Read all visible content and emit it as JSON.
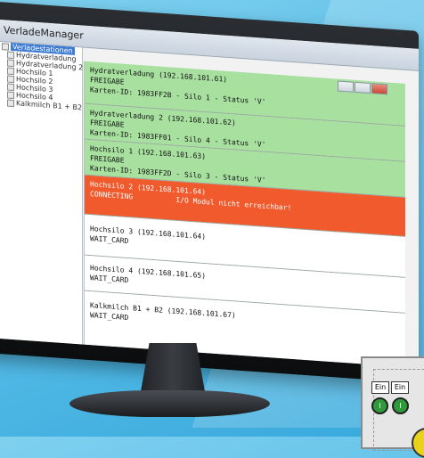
{
  "window": {
    "title": "VerladeManager"
  },
  "tree": {
    "root": "Verladestationen",
    "items": [
      "Hydratverladung",
      "Hydratverladung 2",
      "Hochsilo 1",
      "Hochsilo 2",
      "Hochsilo 3",
      "Hochsilo 4",
      "Kalkmilch B1 + B2"
    ]
  },
  "stations": [
    {
      "status": "green",
      "title": "Hydratverladung (192.168.101.61)",
      "line2": "FREIGABE",
      "line3": "Karten-ID: 1983FF2B - Silo 1 - Status 'V'"
    },
    {
      "status": "green",
      "title": "Hydratverladung 2 (192.168.101.62)",
      "line2": "FREIGABE",
      "line3": "Karten-ID: 1983FF01 - Silo 4 - Status 'V'"
    },
    {
      "status": "green",
      "title": "Hochsilo 1 (192.168.101.63)",
      "line2": "FREIGABE",
      "line3": "Karten-ID: 1983FF2D - Silo 3 - Status 'V'"
    },
    {
      "status": "red",
      "title": "Hochsilo 2 (192.168.101.64)",
      "line2": "CONNECTING          I/O Modul nicht erreichbar!",
      "line3": ""
    },
    {
      "status": "white",
      "title": "Hochsilo 3 (192.168.101.64)",
      "line2": "WAIT_CARD",
      "line3": ""
    },
    {
      "status": "white",
      "title": "Hochsilo 4 (192.168.101.65)",
      "line2": "WAIT_CARD",
      "line3": ""
    },
    {
      "status": "white",
      "title": "Kalkmilch B1 + B2 (192.168.101.67)",
      "line2": "WAIT_CARD",
      "line3": ""
    }
  ],
  "control_box": {
    "left_label": "Ein",
    "right_label": "Ein",
    "button_symbol": "I"
  },
  "colors": {
    "green": "#a8e0a0",
    "red": "#f05a2c",
    "accent": "#3b7bd6"
  }
}
